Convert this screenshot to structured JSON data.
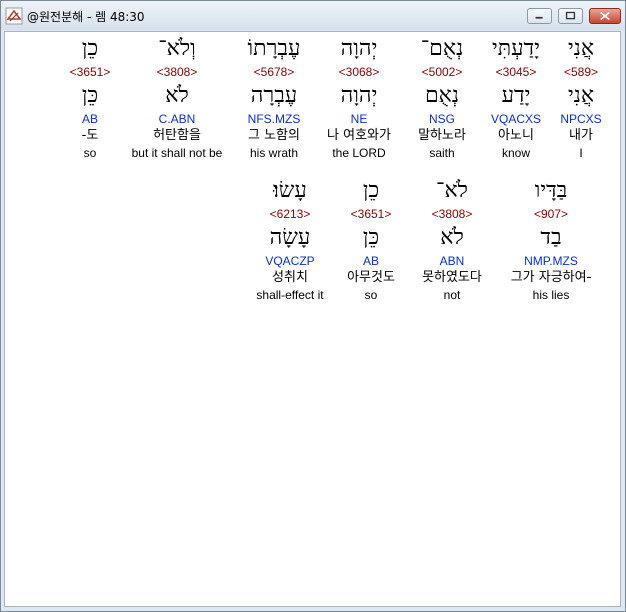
{
  "window": {
    "title": "@원전분해 - 렘 48:30",
    "min_label": "minimize",
    "max_label": "maximize",
    "close_label": "close"
  },
  "rows": [
    {
      "words": [
        {
          "hebrew": "אֲנִי",
          "strong": "<589>",
          "lemma": "אֲנִי",
          "morph": "NPCXS",
          "korean": "내가",
          "english": "I"
        },
        {
          "hebrew": "יָדַעְתִּי",
          "strong": "<3045>",
          "lemma": "יָדַע",
          "morph": "VQACXS",
          "korean": "아노니",
          "english": "know"
        },
        {
          "hebrew": "נְאֻם־",
          "strong": "<5002>",
          "lemma": "נְאֻם",
          "morph": "NSG",
          "korean": "말하노라",
          "english": "saith"
        },
        {
          "hebrew": "יְהוָה",
          "strong": "<3068>",
          "lemma": "יְהוָה",
          "morph": "NE",
          "korean": "나 여호와가",
          "english": "the LORD"
        },
        {
          "hebrew": "עֶבְרָתוֹ",
          "strong": "<5678>",
          "lemma": "עֶבְרָה",
          "morph": "NFS.MZS",
          "korean": "그 노함의",
          "english": "his wrath"
        },
        {
          "hebrew": "וְלֹא־",
          "strong": "<3808>",
          "lemma": "לֹא",
          "morph": "C.ABN",
          "korean": "허탄함을",
          "english": "but it shall not be"
        },
        {
          "hebrew": "כֵן",
          "strong": "<3651>",
          "lemma": "כֵּן",
          "morph": "AB",
          "korean": "-도",
          "english": "so"
        }
      ]
    },
    {
      "words": [
        {
          "hebrew": "בַּדָּיו",
          "strong": "<907>",
          "lemma": "בַד",
          "morph": "NMP.MZS",
          "korean": "그가 자긍하여-",
          "english": "his lies"
        },
        {
          "hebrew": "לֹא־",
          "strong": "<3808>",
          "lemma": "לֹא",
          "morph": "ABN",
          "korean": "못하였도다",
          "english": "not"
        },
        {
          "hebrew": "כֵן",
          "strong": "<3651>",
          "lemma": "כֵּן",
          "morph": "AB",
          "korean": "아무것도",
          "english": "so"
        },
        {
          "hebrew": "עָשׂוּ׃",
          "strong": "<6213>",
          "lemma": "עָשָׂה",
          "morph": "VQACZP",
          "korean": "성취치",
          "english": "shall-effect it"
        }
      ]
    }
  ]
}
